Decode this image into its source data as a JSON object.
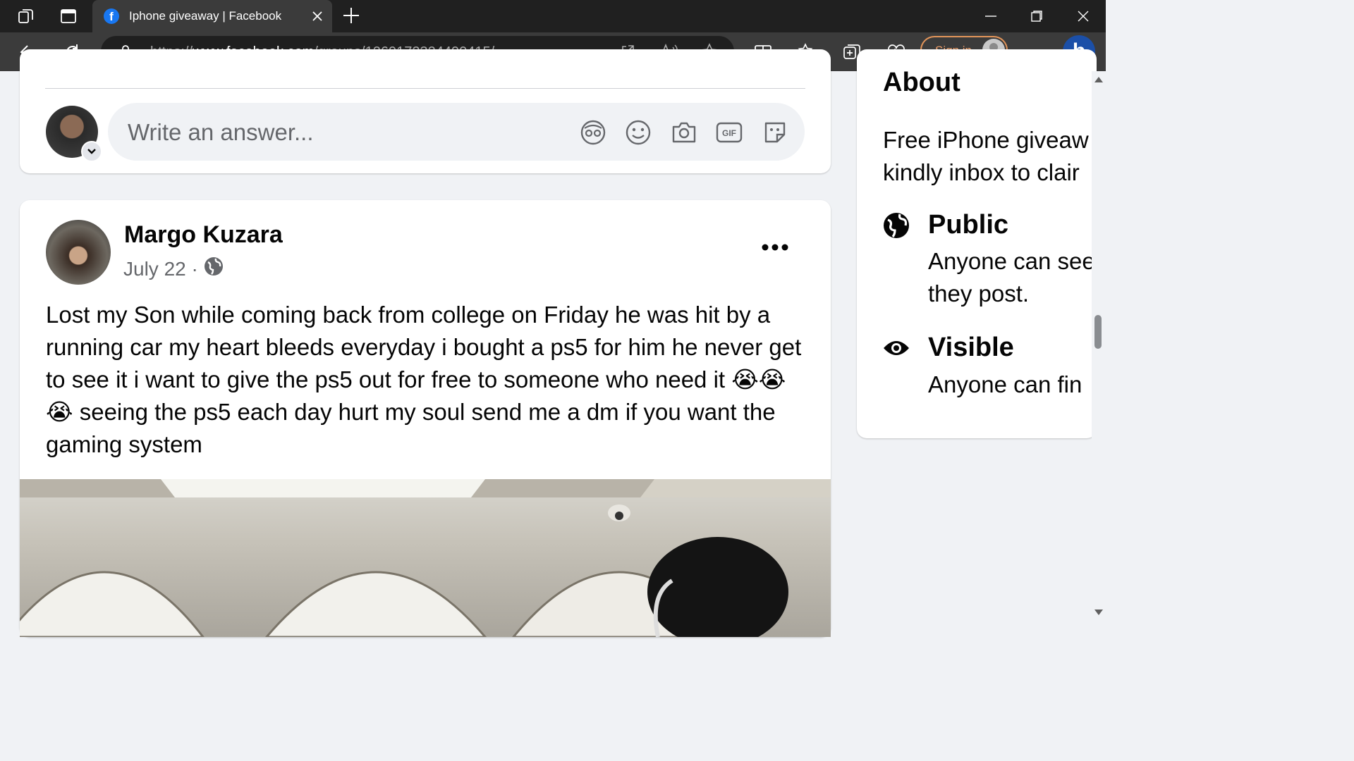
{
  "browser": {
    "tab_title": "Iphone giveaway | Facebook",
    "favicon_letter": "f",
    "url_prefix": "https://",
    "url_domain": "www.facebook.com",
    "url_path": "/groups/1269172324490415/",
    "sign_in_label": "Sign in",
    "bing_letter": "b",
    "tab_icons": [
      "workspaces-icon",
      "vertical-tabs-icon"
    ],
    "toolbar_icons": [
      "open-in-app-icon",
      "read-aloud-icon",
      "favorite-star-icon",
      "split-screen-icon",
      "favorites-icon",
      "collections-icon",
      "browser-essentials-icon",
      "more-options-icon"
    ]
  },
  "comment_box": {
    "placeholder": "Write an answer...",
    "icons": [
      "avatar-sticker-icon",
      "emoji-icon",
      "camera-icon",
      "gif-icon",
      "sticker-icon"
    ]
  },
  "post": {
    "author": "Margo Kuzara",
    "date": "July 22 ·",
    "text": "Lost my Son while coming back from college on Friday he was hit by a running car my heart bleeds everyday i bought a ps5 for him he never get to see it i want to give the ps5 out for free to someone who need it 😭😭😭 seeing the ps5 each day hurt my soul send me a dm if you want the gaming system"
  },
  "about": {
    "title": "About",
    "description_line1": "Free iPhone giveaw",
    "description_line2": "kindly inbox to clair",
    "rows": [
      {
        "title": "Public",
        "sub_line1": "Anyone can see",
        "sub_line2": "they post.",
        "icon": "globe-icon"
      },
      {
        "title": "Visible",
        "sub_line1": "Anyone can fin",
        "icon": "eye-icon"
      }
    ]
  },
  "colors": {
    "chrome_dark": "#202020",
    "chrome_toolbar": "#3b3b3b",
    "facebook_blue": "#1877f2",
    "page_bg": "#f0f2f5",
    "signin_accent": "#e3955a"
  }
}
